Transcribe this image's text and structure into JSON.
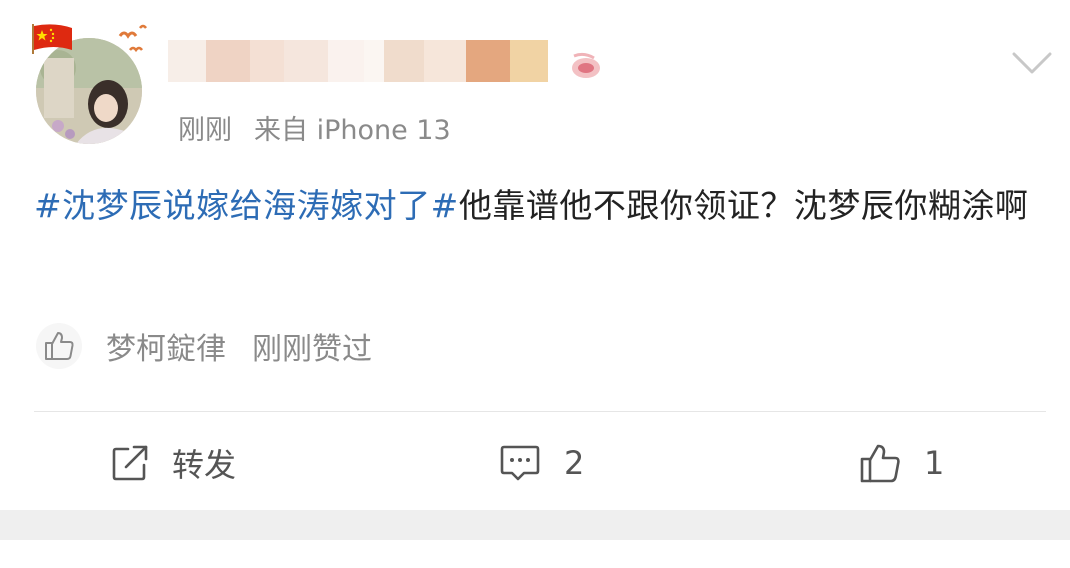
{
  "post": {
    "author_name": "",
    "time": "刚刚",
    "source": "来自 iPhone 13",
    "content": {
      "topic": "#沈梦辰说嫁给海涛嫁对了#",
      "text": "他靠谱他不跟你领证？沈梦辰你糊涂啊"
    },
    "liked_by": {
      "name": "梦柯錠律",
      "action": "刚刚赞过"
    },
    "actions": {
      "forward_label": "转发",
      "comment_count": "2",
      "like_count": "1"
    }
  },
  "colors": {
    "topic_link": "#2d6cb5",
    "meta_text": "#8a8a8a",
    "body_text": "#222222",
    "separator_band": "#efefef"
  },
  "icons": {
    "flag": "china-flag-icon",
    "decoration": "birds-icon",
    "badge": "vip-badge-icon",
    "menu": "chevron-down-icon",
    "like_small": "thumbs-up-icon",
    "forward": "share-icon",
    "comment": "comment-icon",
    "like": "thumbs-up-icon"
  }
}
